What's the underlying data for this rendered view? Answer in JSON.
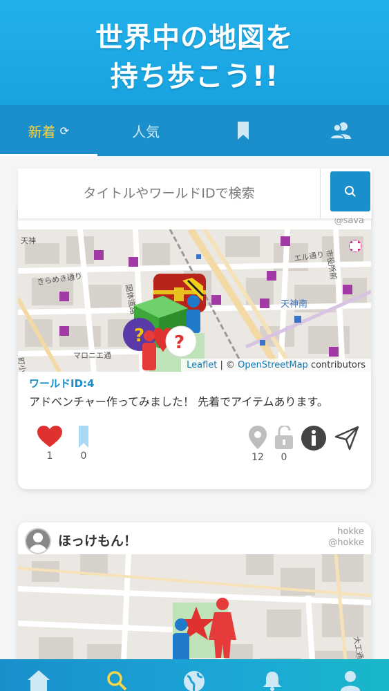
{
  "hero": {
    "line1": "世界中の地図を",
    "line2": "持ち歩こう!!"
  },
  "tabs": [
    {
      "label": "新着",
      "icon": "refresh-icon",
      "active": true
    },
    {
      "label": "人気",
      "active": false
    },
    {
      "label": "",
      "icon": "bookmark-icon",
      "active": false
    },
    {
      "label": "",
      "icon": "users-icon",
      "active": false
    }
  ],
  "search": {
    "placeholder": "タイトルやワールドIDで検索",
    "value": "",
    "button_icon": "search-icon"
  },
  "cards": [
    {
      "handle": "@sava",
      "map": {
        "labels": [
          "天神",
          "天神南",
          "きらめき通り",
          "エル通り",
          "市役所前",
          "マロニエ通",
          "町小路",
          "国体道路"
        ],
        "attribution_leaflet": "Leaflet",
        "attribution_sep": " | © ",
        "attribution_osm": "OpenStreetMap",
        "attribution_tail": " contributors"
      },
      "world_id": "ワールドID:4",
      "description": "アドベンチャー作ってみました！ 先着でアイテムあります。",
      "likes": "1",
      "bookmarks": "0",
      "pins": "12",
      "locks": "0"
    },
    {
      "author": "ほっけもん！",
      "handle_name": "hokke",
      "handle": "@hokke",
      "map": {
        "labels": [
          "大工通り"
        ]
      }
    }
  ],
  "bottom_nav": [
    "home-icon",
    "search-icon",
    "globe-icon",
    "bell-icon",
    "user-icon"
  ],
  "colors": {
    "accent": "#1a8fcb",
    "active_tab": "#f7d64a",
    "heart": "#e03131"
  }
}
